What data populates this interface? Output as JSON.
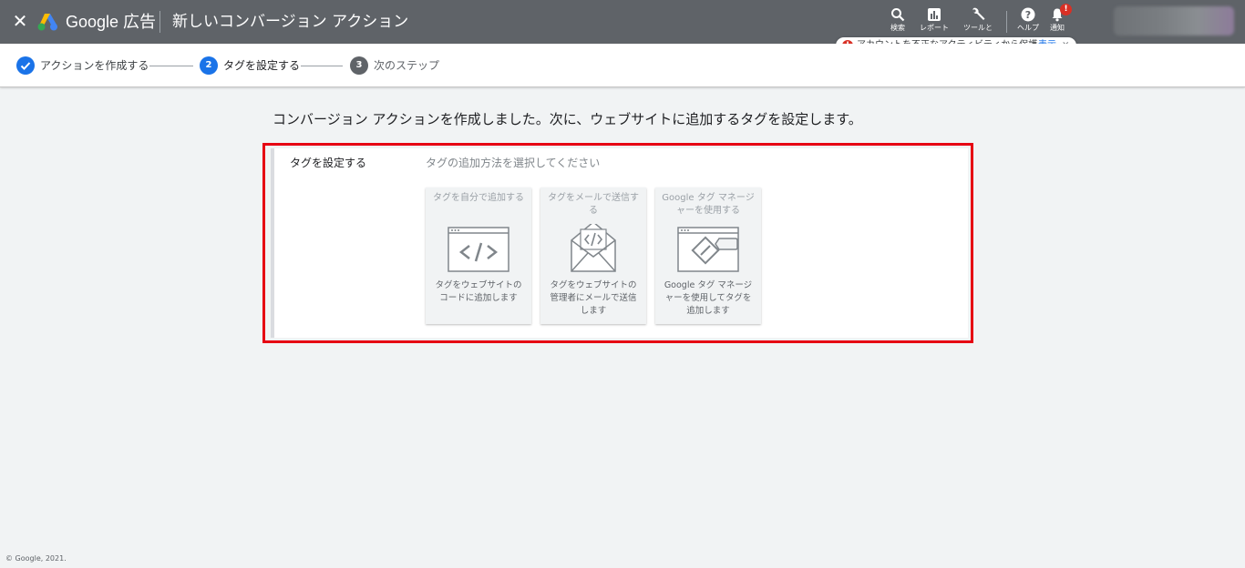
{
  "header": {
    "brand": "Google 広告",
    "page_title": "新しいコンバージョン アクション",
    "buttons": {
      "search": "検索",
      "reports": "レポート",
      "tools": "ツールと",
      "help": "ヘルプ",
      "notifications": "通知"
    },
    "notification_badge": "!"
  },
  "notice": {
    "text": "アカウントを不正なアクティビティから保護",
    "link": "表示",
    "close": "×"
  },
  "stepper": {
    "steps": [
      {
        "label": "アクションを作成する",
        "status": "done"
      },
      {
        "number": "2",
        "label": "タグを設定する",
        "status": "current"
      },
      {
        "number": "3",
        "label": "次のステップ",
        "status": "pending"
      }
    ]
  },
  "main": {
    "headline": "コンバージョン アクションを作成しました。次に、ウェブサイトに追加するタグを設定します。",
    "section_label": "タグを設定する",
    "section_hint": "タグの追加方法を選択してください",
    "options": [
      {
        "title": "タグを自分で追加する",
        "desc": "タグをウェブサイトのコードに追加します"
      },
      {
        "title": "タグをメールで送信する",
        "desc": "タグをウェブサイトの管理者にメールで送信します"
      },
      {
        "title": "Google タグ マネージャーを使用する",
        "desc": "Google タグ マネージャーを使用してタグを追加します"
      }
    ]
  },
  "footer": "© Google, 2021.",
  "colors": {
    "header_bg": "#5f6368",
    "primary": "#1a73e8",
    "highlight_border": "#e60012",
    "error": "#d93025"
  }
}
